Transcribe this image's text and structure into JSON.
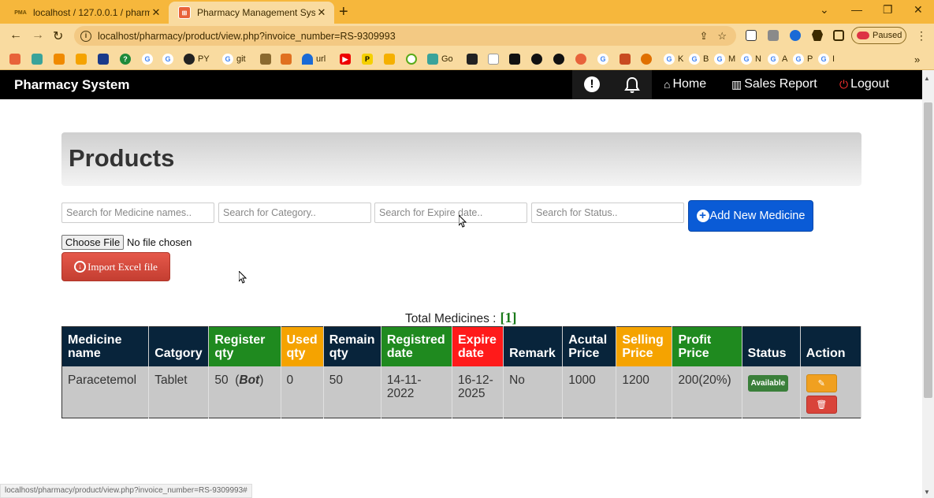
{
  "browser": {
    "tabs": [
      {
        "title": "localhost / 127.0.0.1 / pharmacy",
        "favicon": "pma"
      },
      {
        "title": "Pharmacy Management System",
        "favicon": "pharmacy"
      }
    ],
    "url": "localhost/pharmacy/product/view.php?invoice_number=RS-9309993",
    "profile_label": "Paused",
    "bookmarks": [
      "PY",
      "git",
      "url",
      "Go",
      "K",
      "B",
      "M",
      "N",
      "A",
      "P",
      "I"
    ],
    "status_url": "localhost/pharmacy/product/view.php?invoice_number=RS-9309993#"
  },
  "navbar": {
    "brand": "Pharmacy System",
    "links": [
      {
        "label": "Home",
        "icon": "home-icon"
      },
      {
        "label": "Sales Report",
        "icon": "bar-chart-icon"
      },
      {
        "label": "Logout",
        "icon": "power-icon"
      }
    ]
  },
  "page": {
    "title": "Products",
    "search_placeholders": {
      "name": "Search for Medicine names..",
      "category": "Search for Category..",
      "expire": "Search for Expire date..",
      "status": "Search for Status.."
    },
    "add_button": "Add New Medicine",
    "file_button": "Choose File",
    "file_status": "No file chosen",
    "import_button": "Import Excel file",
    "total_label": "Total Medicines :",
    "total_count": "[1]"
  },
  "table": {
    "headers": [
      {
        "label": "Medicine name",
        "color": "#08243b"
      },
      {
        "label": "Catgory",
        "color": "#08243b"
      },
      {
        "label": "Register qty",
        "color": "#1f8a1f"
      },
      {
        "label": "Used qty",
        "color": "#f5a300"
      },
      {
        "label": "Remain qty",
        "color": "#08243b"
      },
      {
        "label": "Registred date",
        "color": "#1f8a1f"
      },
      {
        "label": "Expire date",
        "color": "#ff1a1a"
      },
      {
        "label": "Remark",
        "color": "#08243b"
      },
      {
        "label": "Acutal Price",
        "color": "#08243b"
      },
      {
        "label": "Selling Price",
        "color": "#f5a300"
      },
      {
        "label": "Profit Price",
        "color": "#1f8a1f"
      },
      {
        "label": "Status",
        "color": "#08243b"
      },
      {
        "label": "Action",
        "color": "#08243b"
      }
    ],
    "rows": [
      {
        "name": "Paracetemol",
        "category": "Tablet",
        "register_qty": "50",
        "unit": "Bot",
        "used_qty": "0",
        "remain_qty": "50",
        "registered_date": "14-11-2022",
        "expire_date": "16-12-2025",
        "remark": "No",
        "actual_price": "1000",
        "selling_price": "1200",
        "profit_price": "200(20%)",
        "status": "Available"
      }
    ]
  }
}
